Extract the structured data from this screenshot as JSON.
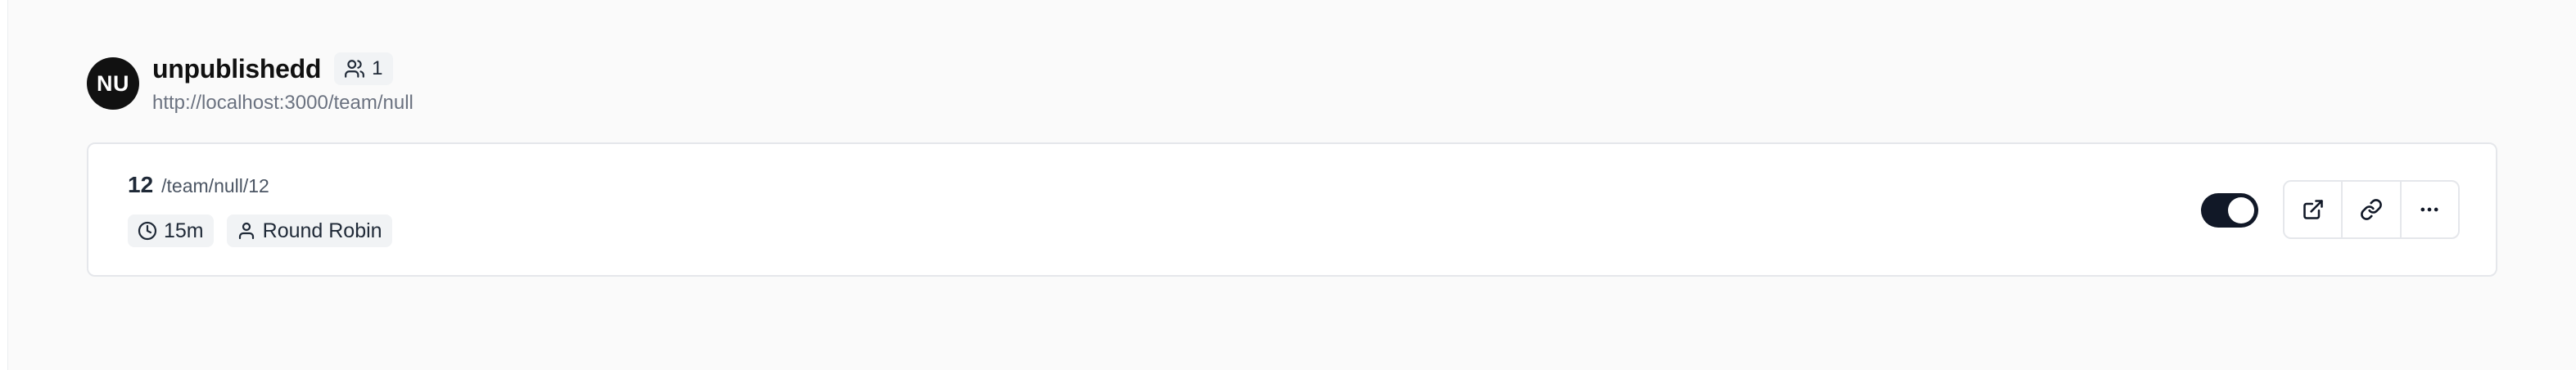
{
  "team": {
    "avatar_initials": "NU",
    "name": "unpublishedd",
    "member_count": "1",
    "url": "http://localhost:3000/team/null"
  },
  "event_type": {
    "title": "12",
    "slug": "/team/null/12",
    "duration": "15m",
    "scheduling_type": "Round Robin",
    "enabled": true
  },
  "icons": {
    "members": "users-icon",
    "duration": "clock-icon",
    "scheduling": "user-icon",
    "preview": "external-link-icon",
    "copy_link": "link-icon",
    "more": "more-horizontal-icon"
  },
  "colors": {
    "toggle_on": "#111827",
    "avatar_bg": "#111111"
  }
}
